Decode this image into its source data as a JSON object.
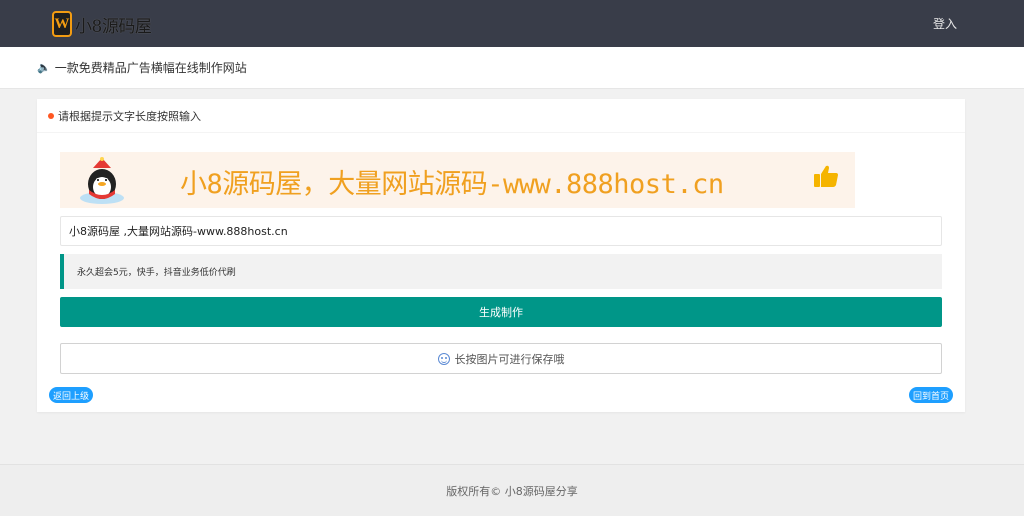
{
  "header": {
    "logo_mark": "W",
    "logo_text": "小8源码屋",
    "login_label": "登入"
  },
  "notice": {
    "text": "一款免费精品广告横幅在线制作网站"
  },
  "card": {
    "header_title": "请根据提示文字长度按照输入",
    "banner_text": "小8源码屋，大量网站源码-www.888host.cn",
    "input_value": "小8源码屋 ,大量网站源码-www.888host.cn",
    "quote_text": "永久超会5元，快手，抖音业务低价代刷",
    "generate_label": "生成制作",
    "save_hint": "长按图片可进行保存哦",
    "back_label": "返回上级",
    "home_label": "回到首页"
  },
  "footer": {
    "text": "版权所有© 小8源码屋分享"
  },
  "colors": {
    "topbar": "#393d49",
    "accent": "#009688",
    "pill": "#1e9fff",
    "banner_text": "#f0a020",
    "dot": "#ff5722"
  },
  "icons": [
    "logo-icon",
    "speaker-icon",
    "dot-icon",
    "penguin-icon",
    "thumbs-up-icon",
    "smile-icon"
  ]
}
